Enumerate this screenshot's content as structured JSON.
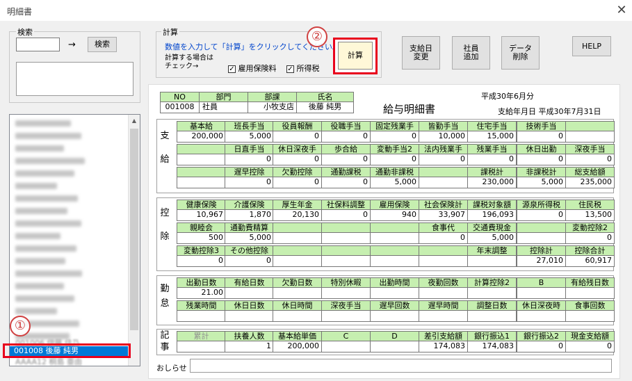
{
  "window": {
    "title": "明細書",
    "close": "✕"
  },
  "search": {
    "group_label": "検索",
    "input_value": "",
    "arrow": "→",
    "button": "検索"
  },
  "list": {
    "selected": "001008 後藤 純男",
    "above_selected": "001006 伊藤 佳乃",
    "below_selected": "AAAA12 桐島 亜由"
  },
  "calc": {
    "group_label": "計算",
    "instruction": "数値を入力して「計算」をクリックしてください。",
    "check_label": "計算する場合は\nチェック→",
    "koyo_label": "雇用保険料",
    "koyo_checked": "✓",
    "shotoku_label": "所得税",
    "shotoku_checked": "✓",
    "button": "計算"
  },
  "toolbar": {
    "pay_date_change": [
      "支給日",
      "変更"
    ],
    "add_employee": [
      "社員",
      "追加"
    ],
    "delete_data": [
      "データ",
      "削除"
    ],
    "help": "HELP"
  },
  "annotations": {
    "one": "①",
    "two": "②"
  },
  "header": {
    "no_label": "NO",
    "no_value": "001008",
    "dept_label": "部門",
    "dept_value": "社員",
    "section_label": "部課",
    "section_value": "小牧支店",
    "name_label": "氏名",
    "name_value": "後藤 純男",
    "doc_title": "給与明細書",
    "period": "平成30年6月分",
    "pay_date": "支給年月日 平成30年7月31日"
  },
  "sections": {
    "shikyu": [
      "支",
      "給"
    ],
    "kojo": [
      "控",
      "除"
    ],
    "kintai": [
      "勤",
      "怠"
    ],
    "kiji": [
      "記",
      "事"
    ]
  },
  "shikyu_rows": [
    {
      "labels": [
        "基本給",
        "班長手当",
        "役員報酬",
        "役職手当",
        "固定残業手",
        "皆勤手当",
        "住宅手当",
        "技術手当",
        ""
      ],
      "values": [
        "200,000",
        "5,000",
        "0",
        "0",
        "0",
        "10,000",
        "15,000",
        "0",
        ""
      ]
    },
    {
      "labels": [
        "",
        "日直手当",
        "休日深夜手",
        "歩合給",
        "変動手当2",
        "法内残業手",
        "残業手当",
        "休日出勤",
        "深夜手当"
      ],
      "values": [
        "",
        "0",
        "0",
        "0",
        "0",
        "0",
        "0",
        "0",
        "0"
      ]
    },
    {
      "labels": [
        "",
        "遅早控除",
        "欠勤控除",
        "通勤課税",
        "通勤非課税",
        "",
        "課税計",
        "非課税計",
        "総支給額"
      ],
      "values": [
        "",
        "0",
        "0",
        "0",
        "5,000",
        "",
        "230,000",
        "5,000",
        "235,000"
      ]
    }
  ],
  "kojo_rows": [
    {
      "labels": [
        "健康保険",
        "介護保険",
        "厚生年金",
        "社保料調整",
        "雇用保険",
        "社会保険計",
        "課税対象額",
        "源泉所得税",
        "住民税"
      ],
      "values": [
        "10,967",
        "1,870",
        "20,130",
        "0",
        "940",
        "33,907",
        "196,093",
        "0",
        "13,500"
      ]
    },
    {
      "labels": [
        "親睦会",
        "通勤費精算",
        "",
        "",
        "",
        "食事代",
        "交通費現金",
        "",
        "変動控除2"
      ],
      "values": [
        "500",
        "5,000",
        "",
        "",
        "",
        "0",
        "5,000",
        "",
        "0"
      ]
    },
    {
      "labels": [
        "変動控除3",
        "その他控除",
        "",
        "",
        "",
        "",
        "年末調整",
        "控除計",
        "控除合計"
      ],
      "values": [
        "0",
        "0",
        "",
        "",
        "",
        "",
        "",
        "27,010",
        "60,917"
      ]
    }
  ],
  "kintai_rows": [
    {
      "labels": [
        "出勤日数",
        "有給日数",
        "欠勤日数",
        "特別休暇",
        "出勤時間",
        "夜勤回数",
        "計算控除2",
        "B",
        "有給残日数"
      ],
      "values": [
        "21.00",
        "",
        "",
        "",
        "",
        "",
        "",
        "",
        ""
      ]
    },
    {
      "labels": [
        "残業時間",
        "休日日数",
        "休日時間",
        "深夜手当",
        "遅早回数",
        "遅早時間",
        "調整日数",
        "休日深夜時",
        "食事回数"
      ],
      "values": [
        "",
        "",
        "",
        "",
        "",
        "",
        "",
        "",
        ""
      ]
    }
  ],
  "kiji_row": {
    "labels": [
      "累計",
      "扶養人数",
      "基本給単価",
      "C",
      "D",
      "差引支給額",
      "銀行振込1",
      "銀行振込2",
      "現金支給額"
    ],
    "values": [
      "",
      "1",
      "200,000",
      "",
      "",
      "174,083",
      "174,083",
      "0",
      "0"
    ]
  },
  "notice": {
    "label": "おしらせ",
    "value": ""
  }
}
